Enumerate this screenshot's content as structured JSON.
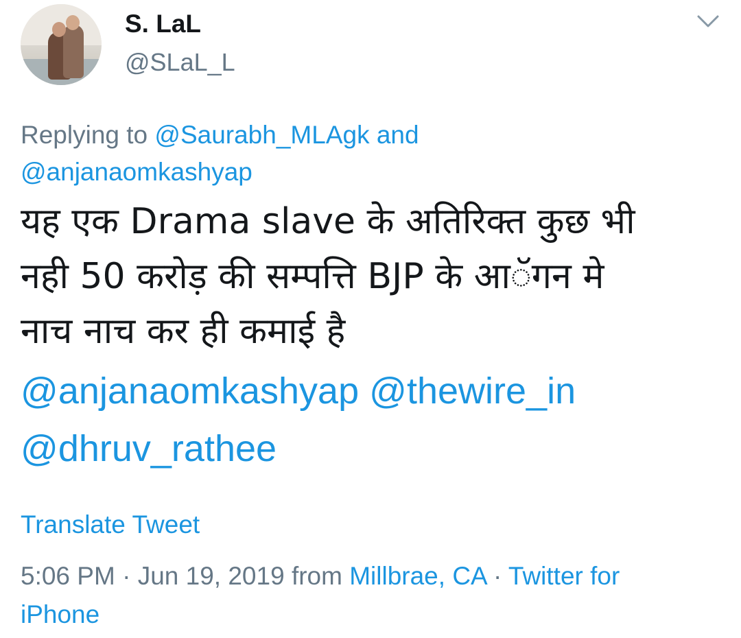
{
  "author": {
    "display_name": "S. LaL",
    "handle": "@SLaL_L"
  },
  "reply": {
    "prefix": "Replying to",
    "mention1": "@Saurabh_MLAgk",
    "conjunction": "and",
    "mention2": "@anjanaomkashyap"
  },
  "tweet": {
    "line1": "यह एक Drama slave के अतिरिक्त कुछ भी",
    "line2": "नही 50 करोड़ की सम्पत्ति BJP के आॅगन मे",
    "line3": "नाच नाच कर ही कमाई है",
    "mention1": "@anjanaomkashyap",
    "mention2": "@thewire_in",
    "mention3": "@dhruv_rathee"
  },
  "translate_label": "Translate Tweet",
  "meta": {
    "time": "5:06 PM",
    "separator": "·",
    "date": "Jun 19, 2019",
    "from": "from",
    "location": "Millbrae, CA",
    "source_line1": "Twitter for",
    "source_line2": "iPhone"
  },
  "icons": {
    "menu": "chevron-down-icon"
  },
  "colors": {
    "link": "#1b95e0",
    "secondary": "#657786",
    "primary": "#14171a",
    "background": "#ffffff"
  }
}
